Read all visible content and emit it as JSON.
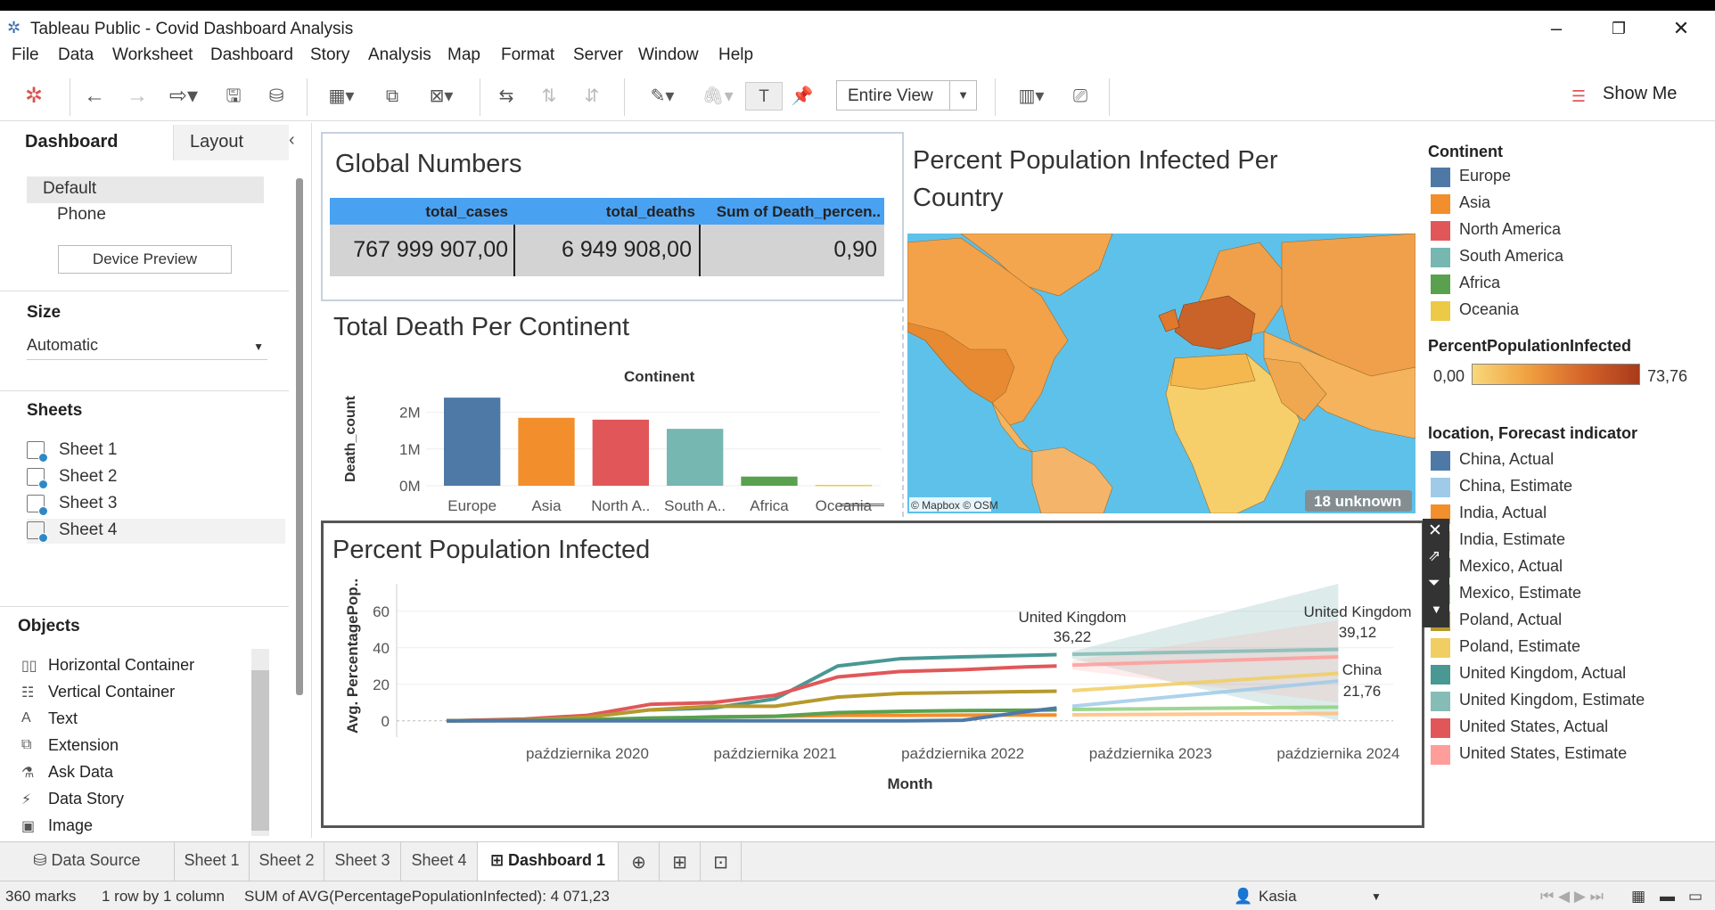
{
  "window": {
    "title": "Tableau Public - Covid Dashboard Analysis"
  },
  "menu": [
    "File",
    "Data",
    "Worksheet",
    "Dashboard",
    "Story",
    "Analysis",
    "Map",
    "Format",
    "Server",
    "Window",
    "Help"
  ],
  "toolbar": {
    "view_mode": "Entire View",
    "show_me": "Show Me"
  },
  "left_panel": {
    "tab_dashboard": "Dashboard",
    "tab_layout": "Layout",
    "device_default": "Default",
    "device_phone": "Phone",
    "device_preview": "Device Preview",
    "size_heading": "Size",
    "size_value": "Automatic",
    "sheets_heading": "Sheets",
    "sheets": [
      "Sheet 1",
      "Sheet 2",
      "Sheet 3",
      "Sheet 4"
    ],
    "objects_heading": "Objects",
    "objects": [
      "Horizontal Container",
      "Vertical Container",
      "Text",
      "Extension",
      "Ask Data",
      "Data Story",
      "Image"
    ]
  },
  "global_numbers": {
    "title": "Global Numbers",
    "headers": [
      "total_cases",
      "total_deaths",
      "Sum of Death_percen.."
    ],
    "values": [
      "767 999 907,00",
      "6 949 908,00",
      "0,90"
    ]
  },
  "death_chart": {
    "title": "Total Death Per Continent",
    "header": "Continent",
    "ylabel": "Death_count",
    "yticks": [
      "2M",
      "1M",
      "0M"
    ],
    "labels": [
      "Europe",
      "Asia",
      "North A..",
      "South A..",
      "Africa",
      "Oceania"
    ]
  },
  "map": {
    "title_line1": "Percent Population Infected Per",
    "title_line2": "Country",
    "credit": "© Mapbox © OSM",
    "unknown": "18 unknown"
  },
  "legend_continent": {
    "title": "Continent",
    "items": [
      {
        "label": "Europe",
        "color": "#4e79a7"
      },
      {
        "label": "Asia",
        "color": "#f28e2b"
      },
      {
        "label": "North America",
        "color": "#e15759"
      },
      {
        "label": "South America",
        "color": "#76b7b2"
      },
      {
        "label": "Africa",
        "color": "#59a14f"
      },
      {
        "label": "Oceania",
        "color": "#edc948"
      }
    ]
  },
  "legend_percent": {
    "title": "PercentPopulationInfected",
    "min": "0,00",
    "max": "73,76"
  },
  "legend_location": {
    "title": "location, Forecast indicator",
    "items": [
      {
        "label": "China, Actual",
        "color": "#4e79a7"
      },
      {
        "label": "China, Estimate",
        "color": "#a0cbe8"
      },
      {
        "label": "India, Actual",
        "color": "#f28e2b"
      },
      {
        "label": "India, Estimate",
        "color": "#ffbe7d"
      },
      {
        "label": "Mexico, Actual",
        "color": "#59a14f"
      },
      {
        "label": "Mexico, Estimate",
        "color": "#8cd17d"
      },
      {
        "label": "Poland, Actual",
        "color": "#b6992d"
      },
      {
        "label": "Poland, Estimate",
        "color": "#f1ce63"
      },
      {
        "label": "United Kingdom, Actual",
        "color": "#499894"
      },
      {
        "label": "United Kingdom, Estimate",
        "color": "#86bcb6"
      },
      {
        "label": "United States, Actual",
        "color": "#e15759"
      },
      {
        "label": "United States, Estimate",
        "color": "#ff9d9a"
      }
    ]
  },
  "line_chart": {
    "title": "Percent Population Infected",
    "ylabel": "Avg. PercentagePop..",
    "xlabel": "Month",
    "yticks": [
      "60",
      "40",
      "20",
      "0"
    ],
    "xticks": [
      "października 2020",
      "października 2021",
      "października 2022",
      "października 2023",
      "października 2024"
    ],
    "annotations": [
      {
        "label": "United Kingdom",
        "value": "36,22"
      },
      {
        "label": "United Kingdom",
        "value": "39,12"
      },
      {
        "label": "China",
        "value": "21,76"
      }
    ]
  },
  "chart_data": [
    {
      "type": "bar",
      "title": "Total Death Per Continent",
      "categories": [
        "Europe",
        "Asia",
        "North America",
        "South America",
        "Africa",
        "Oceania"
      ],
      "values": [
        2400000,
        1850000,
        1800000,
        1550000,
        250000,
        25000
      ],
      "ylabel": "Death_count",
      "ylim": [
        0,
        2500000
      ],
      "colors": [
        "#4e79a7",
        "#f28e2b",
        "#e15759",
        "#76b7b2",
        "#59a14f",
        "#edc948"
      ]
    },
    {
      "type": "line",
      "title": "Percent Population Infected",
      "xlabel": "Month",
      "ylabel": "Avg. PercentagePop..",
      "x": [
        "2020-01",
        "2020-06",
        "2020-10",
        "2021-02",
        "2021-06",
        "2021-10",
        "2022-02",
        "2022-06",
        "2022-10",
        "2023-02",
        "2023-04"
      ],
      "ylim": [
        -5,
        75
      ],
      "series": [
        {
          "name": "United Kingdom, Actual",
          "color": "#499894",
          "values": [
            0,
            0.5,
            2,
            6,
            7,
            12,
            30,
            34,
            35,
            35.8,
            36.2
          ]
        },
        {
          "name": "United States, Actual",
          "color": "#e15759",
          "values": [
            0,
            1,
            3,
            9,
            10,
            14,
            24,
            27,
            28,
            29.5,
            30
          ]
        },
        {
          "name": "Poland, Actual",
          "color": "#b6992d",
          "values": [
            0,
            0.3,
            2,
            6,
            8,
            8,
            13,
            15,
            15.5,
            16,
            16.2
          ]
        },
        {
          "name": "India, Actual",
          "color": "#f28e2b",
          "values": [
            0,
            0.2,
            0.5,
            1,
            2.2,
            2.5,
            3,
            3,
            3.1,
            3.2,
            3.2
          ]
        },
        {
          "name": "Mexico, Actual",
          "color": "#59a14f",
          "values": [
            0,
            0.2,
            0.6,
            1.5,
            2,
            2.5,
            4.5,
            5.2,
            5.6,
            5.8,
            6
          ]
        },
        {
          "name": "China, Actual",
          "color": "#4e79a7",
          "values": [
            0,
            0,
            0,
            0,
            0,
            0,
            0,
            0,
            0.3,
            5,
            7
          ]
        }
      ]
    }
  ],
  "bottom_tabs": [
    "Data Source",
    "Sheet 1",
    "Sheet 2",
    "Sheet 3",
    "Sheet 4",
    "Dashboard 1"
  ],
  "status": {
    "marks": "360 marks",
    "rows": "1 row by 1 column",
    "sum": "SUM of AVG(PercentagePopulationInfected): 4 071,23",
    "user": "Kasia"
  }
}
